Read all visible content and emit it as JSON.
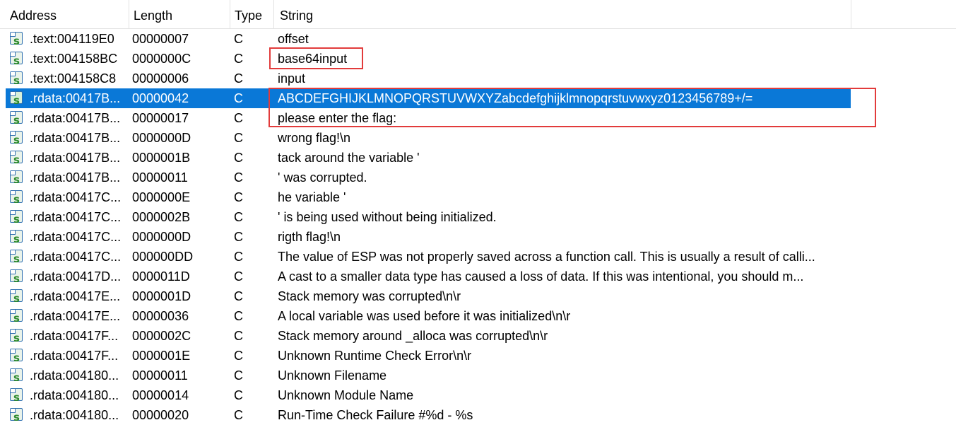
{
  "columns": {
    "address": "Address",
    "length": "Length",
    "type": "Type",
    "string": "String"
  },
  "icon": "string-icon",
  "selected_row_index": 3,
  "highlight_color": "#0a78d7",
  "annotation_color": "#e23b3b",
  "rows": [
    {
      "address": ".text:004119E0",
      "length": "00000007",
      "type": "C",
      "string": "offset"
    },
    {
      "address": ".text:004158BC",
      "length": "0000000C",
      "type": "C",
      "string": "base64input"
    },
    {
      "address": ".text:004158C8",
      "length": "00000006",
      "type": "C",
      "string": "input"
    },
    {
      "address": ".rdata:00417B...",
      "length": "00000042",
      "type": "C",
      "string": "ABCDEFGHIJKLMNOPQRSTUVWXYZabcdefghijklmnopqrstuvwxyz0123456789+/="
    },
    {
      "address": ".rdata:00417B...",
      "length": "00000017",
      "type": "C",
      "string": "please enter the flag:"
    },
    {
      "address": ".rdata:00417B...",
      "length": "0000000D",
      "type": "C",
      "string": "wrong flag!\\n"
    },
    {
      "address": ".rdata:00417B...",
      "length": "0000001B",
      "type": "C",
      "string": "tack around the variable '"
    },
    {
      "address": ".rdata:00417B...",
      "length": "00000011",
      "type": "C",
      "string": "' was corrupted."
    },
    {
      "address": ".rdata:00417C...",
      "length": "0000000E",
      "type": "C",
      "string": "he variable '"
    },
    {
      "address": ".rdata:00417C...",
      "length": "0000002B",
      "type": "C",
      "string": "' is being used without being initialized."
    },
    {
      "address": ".rdata:00417C...",
      "length": "0000000D",
      "type": "C",
      "string": "rigth flag!\\n"
    },
    {
      "address": ".rdata:00417C...",
      "length": "000000DD",
      "type": "C",
      "string": "The value of ESP was not properly saved across a function call.  This is usually a result of calli..."
    },
    {
      "address": ".rdata:00417D...",
      "length": "0000011D",
      "type": "C",
      "string": "A cast to a smaller data type has caused a loss of data.  If this was intentional, you should m..."
    },
    {
      "address": ".rdata:00417E...",
      "length": "0000001D",
      "type": "C",
      "string": "Stack memory was corrupted\\n\\r"
    },
    {
      "address": ".rdata:00417E...",
      "length": "00000036",
      "type": "C",
      "string": "A local variable was used before it was initialized\\n\\r"
    },
    {
      "address": ".rdata:00417F...",
      "length": "0000002C",
      "type": "C",
      "string": "Stack memory around _alloca was corrupted\\n\\r"
    },
    {
      "address": ".rdata:00417F...",
      "length": "0000001E",
      "type": "C",
      "string": "Unknown Runtime Check Error\\n\\r"
    },
    {
      "address": ".rdata:004180...",
      "length": "00000011",
      "type": "C",
      "string": "Unknown Filename"
    },
    {
      "address": ".rdata:004180...",
      "length": "00000014",
      "type": "C",
      "string": "Unknown Module Name"
    },
    {
      "address": ".rdata:004180...",
      "length": "00000020",
      "type": "C",
      "string": "Run-Time Check Failure #%d - %s"
    }
  ]
}
